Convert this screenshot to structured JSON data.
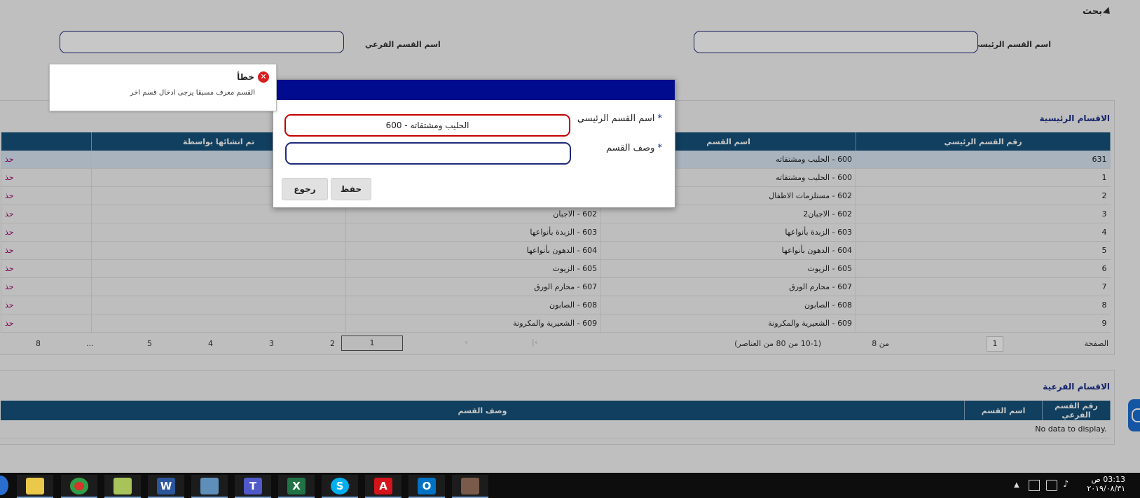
{
  "search": {
    "title": "بحث",
    "main_label": "اسم القسم الرئيسي",
    "sub_label": "اسم القسم الفرعي"
  },
  "main_section": {
    "title": "الاقسام الرئيسية",
    "columns": [
      "رقم القسم الرئيسي",
      "اسم القسم",
      "",
      "تم انشائها بواسطة"
    ],
    "rows": [
      {
        "num": "631",
        "name": "600 - الحليب ومشتقاته",
        "desc": "",
        "edge": "حذ"
      },
      {
        "num": "1",
        "name": "600 - الحليب ومشتقاته",
        "desc": "",
        "edge": "حذ"
      },
      {
        "num": "2",
        "name": "602 - مستلزمات الاطفال",
        "desc": "",
        "edge": "حذ"
      },
      {
        "num": "3",
        "name": "602 - الاجبان2",
        "desc": "602 - الاجبان",
        "edge": "حذ"
      },
      {
        "num": "4",
        "name": "603 - الزبدة بأنواعها",
        "desc": "603 - الزبدة بأنواعها",
        "edge": "حذ"
      },
      {
        "num": "5",
        "name": "604 - الدهون بأنواعها",
        "desc": "604 - الدهون بأنواعها",
        "edge": "حذ"
      },
      {
        "num": "6",
        "name": "605 - الزيوت",
        "desc": "605 - الزيوت",
        "edge": "حذ"
      },
      {
        "num": "7",
        "name": "607 - محارم الورق",
        "desc": "607 - محارم الورق",
        "edge": "حذ"
      },
      {
        "num": "8",
        "name": "608 - الصابون",
        "desc": "608 - الصابون",
        "edge": "حذ"
      },
      {
        "num": "9",
        "name": "609 - الشعيرية والمكرونة",
        "desc": "609 - الشعيرية والمكرونة",
        "edge": "حذ"
      }
    ],
    "pager": {
      "page_label": "الصفحة",
      "page_value": "1",
      "of_label": "من 8",
      "range_text": "(10-1 من 80 من العناصر)",
      "pages": [
        "1",
        "2",
        "3",
        "4",
        "5",
        "...",
        "8"
      ]
    }
  },
  "sub_section": {
    "title": "الاقسام الفرعية",
    "columns": [
      "رقم القسم الفرعي",
      "اسم القسم",
      "وصف القسم"
    ],
    "empty_text": "No data to display."
  },
  "modal": {
    "field1_label": "اسم القسم الرئيسي",
    "field1_value": "600 - الحليب ومشتقاته",
    "field2_label": "وصف القسم",
    "field2_value": "",
    "required_mark": "*",
    "save_label": "حفظ",
    "back_label": "رجوع"
  },
  "error_tooltip": {
    "title": "خطأ",
    "message": "القسم معرف مسبقا يرجى ادخال قسم اخر"
  },
  "taskbar": {
    "time": "03:13 ص",
    "date": "٢٠١٩/٠٨/٣١"
  },
  "colors": {
    "modal_header": "#000c8d",
    "table_header": "#17517a",
    "error_border": "#c40000",
    "section_title": "#1a2f8a"
  }
}
